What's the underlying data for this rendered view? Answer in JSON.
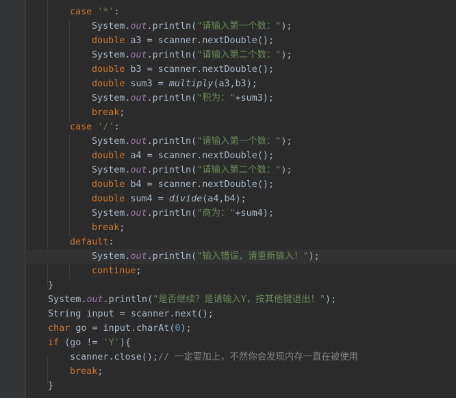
{
  "editor": {
    "lines": [
      {
        "indent": 2,
        "tokens": [
          {
            "t": "kw",
            "v": "case "
          },
          {
            "t": "str",
            "v": "'*'"
          },
          {
            "t": "txt",
            "v": ":"
          }
        ]
      },
      {
        "indent": 3,
        "tokens": [
          {
            "t": "txt",
            "v": "System."
          },
          {
            "t": "fld",
            "v": "out"
          },
          {
            "t": "txt",
            "v": ".println("
          },
          {
            "t": "str",
            "v": "\"请输入第一个数：\""
          },
          {
            "t": "txt",
            "v": ");"
          }
        ]
      },
      {
        "indent": 3,
        "tokens": [
          {
            "t": "kw",
            "v": "double "
          },
          {
            "t": "txt",
            "v": "a3 = scanner.nextDouble();"
          }
        ]
      },
      {
        "indent": 3,
        "tokens": [
          {
            "t": "txt",
            "v": "System."
          },
          {
            "t": "fld",
            "v": "out"
          },
          {
            "t": "txt",
            "v": ".println("
          },
          {
            "t": "str",
            "v": "\"请输入第二个数：\""
          },
          {
            "t": "txt",
            "v": ");"
          }
        ]
      },
      {
        "indent": 3,
        "tokens": [
          {
            "t": "kw",
            "v": "double "
          },
          {
            "t": "txt",
            "v": "b3 = scanner.nextDouble();"
          }
        ]
      },
      {
        "indent": 3,
        "tokens": [
          {
            "t": "kw",
            "v": "double "
          },
          {
            "t": "txt",
            "v": "sum3 = "
          },
          {
            "t": "sfn",
            "v": "multiply"
          },
          {
            "t": "txt",
            "v": "(a3,b3);"
          }
        ]
      },
      {
        "indent": 3,
        "tokens": [
          {
            "t": "txt",
            "v": "System."
          },
          {
            "t": "fld",
            "v": "out"
          },
          {
            "t": "txt",
            "v": ".println("
          },
          {
            "t": "str",
            "v": "\"积为：\""
          },
          {
            "t": "txt",
            "v": "+sum3);"
          }
        ]
      },
      {
        "indent": 3,
        "tokens": [
          {
            "t": "kw",
            "v": "break"
          },
          {
            "t": "txt",
            "v": ";"
          }
        ]
      },
      {
        "indent": 2,
        "tokens": [
          {
            "t": "kw",
            "v": "case "
          },
          {
            "t": "str",
            "v": "'/'"
          },
          {
            "t": "txt",
            "v": ":"
          }
        ]
      },
      {
        "indent": 3,
        "tokens": [
          {
            "t": "txt",
            "v": "System."
          },
          {
            "t": "fld",
            "v": "out"
          },
          {
            "t": "txt",
            "v": ".println("
          },
          {
            "t": "str",
            "v": "\"请输入第一个数：\""
          },
          {
            "t": "txt",
            "v": ");"
          }
        ]
      },
      {
        "indent": 3,
        "tokens": [
          {
            "t": "kw",
            "v": "double "
          },
          {
            "t": "txt",
            "v": "a4 = scanner.nextDouble();"
          }
        ]
      },
      {
        "indent": 3,
        "tokens": [
          {
            "t": "txt",
            "v": "System."
          },
          {
            "t": "fld",
            "v": "out"
          },
          {
            "t": "txt",
            "v": ".println("
          },
          {
            "t": "str",
            "v": "\"请输入第二个数：\""
          },
          {
            "t": "txt",
            "v": ");"
          }
        ]
      },
      {
        "indent": 3,
        "tokens": [
          {
            "t": "kw",
            "v": "double "
          },
          {
            "t": "txt",
            "v": "b4 = scanner.nextDouble();"
          }
        ]
      },
      {
        "indent": 3,
        "tokens": [
          {
            "t": "kw",
            "v": "double "
          },
          {
            "t": "txt",
            "v": "sum4 = "
          },
          {
            "t": "sfn",
            "v": "divide"
          },
          {
            "t": "txt",
            "v": "(a4,b4);"
          }
        ]
      },
      {
        "indent": 3,
        "tokens": [
          {
            "t": "txt",
            "v": "System."
          },
          {
            "t": "fld",
            "v": "out"
          },
          {
            "t": "txt",
            "v": ".println("
          },
          {
            "t": "str",
            "v": "\"商为：\""
          },
          {
            "t": "txt",
            "v": "+sum4);"
          }
        ]
      },
      {
        "indent": 3,
        "tokens": [
          {
            "t": "kw",
            "v": "break"
          },
          {
            "t": "txt",
            "v": ";"
          }
        ]
      },
      {
        "indent": 2,
        "tokens": [
          {
            "t": "kw",
            "v": "default"
          },
          {
            "t": "txt",
            "v": ":"
          }
        ]
      },
      {
        "indent": 3,
        "current": true,
        "tokens": [
          {
            "t": "txt",
            "v": "System."
          },
          {
            "t": "fld",
            "v": "out"
          },
          {
            "t": "txt",
            "v": ".println("
          },
          {
            "t": "str",
            "v": "\"输入错误，请重新输入！\""
          },
          {
            "t": "txt",
            "v": ");"
          }
        ]
      },
      {
        "indent": 3,
        "tokens": [
          {
            "t": "kw",
            "v": "continue"
          },
          {
            "t": "txt",
            "v": ";"
          }
        ]
      },
      {
        "indent": 1,
        "tokens": [
          {
            "t": "txt",
            "v": "}"
          }
        ]
      },
      {
        "indent": 1,
        "tokens": [
          {
            "t": "txt",
            "v": "System."
          },
          {
            "t": "fld",
            "v": "out"
          },
          {
            "t": "txt",
            "v": ".println("
          },
          {
            "t": "str",
            "v": "\"是否继续？是请输入Y，按其他键退出！\""
          },
          {
            "t": "txt",
            "v": ");"
          }
        ]
      },
      {
        "indent": 1,
        "tokens": [
          {
            "t": "txt",
            "v": "String input = scanner.next();"
          }
        ]
      },
      {
        "indent": 1,
        "tokens": [
          {
            "t": "kw",
            "v": "char "
          },
          {
            "t": "txt",
            "v": "go = input.charAt("
          },
          {
            "t": "num",
            "v": "0"
          },
          {
            "t": "txt",
            "v": ");"
          }
        ]
      },
      {
        "indent": 1,
        "tokens": [
          {
            "t": "kw",
            "v": "if "
          },
          {
            "t": "txt",
            "v": "(go != "
          },
          {
            "t": "str",
            "v": "'Y'"
          },
          {
            "t": "txt",
            "v": "){"
          }
        ]
      },
      {
        "indent": 2,
        "tokens": [
          {
            "t": "txt",
            "v": "scanner.close();"
          },
          {
            "t": "cm",
            "v": "// 一定要加上，不然你会发现内存一直在被使用"
          }
        ]
      },
      {
        "indent": 2,
        "tokens": [
          {
            "t": "kw",
            "v": "break"
          },
          {
            "t": "txt",
            "v": ";"
          }
        ]
      },
      {
        "indent": 1,
        "tokens": [
          {
            "t": "txt",
            "v": "}"
          }
        ]
      }
    ]
  }
}
